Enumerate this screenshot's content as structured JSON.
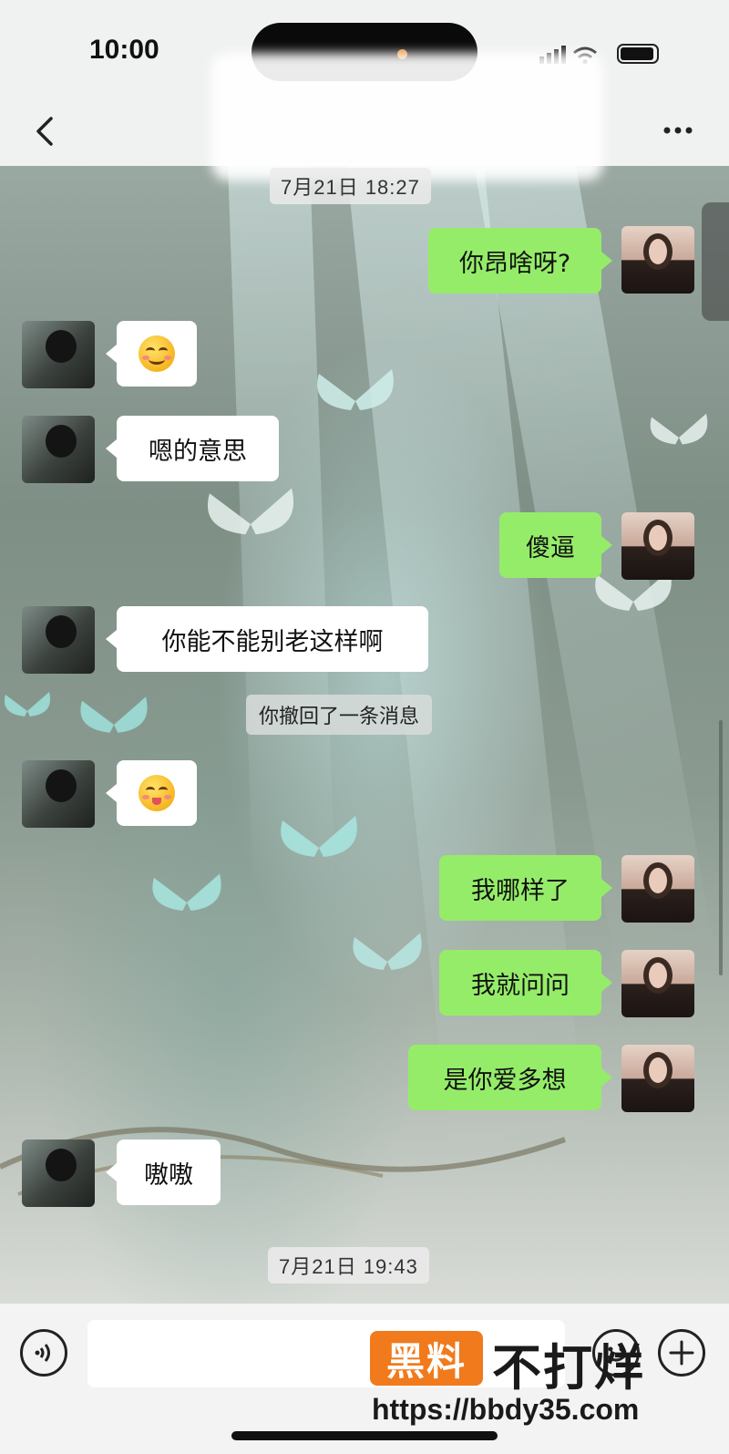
{
  "status": {
    "time": "10:00"
  },
  "timestamps": [
    "7月21日 18:27",
    "7月21日 19:43"
  ],
  "messages": [
    {
      "side": "out",
      "text": "你昂啥呀?"
    },
    {
      "side": "in",
      "emoji": "smiling-face-emoji"
    },
    {
      "side": "in",
      "text": "嗯的意思"
    },
    {
      "side": "out",
      "text": "傻逼"
    },
    {
      "side": "in",
      "text": "你能不能别老这样啊"
    },
    {
      "side": "system",
      "text": "你撤回了一条消息"
    },
    {
      "side": "in",
      "emoji": "tongue-face-emoji"
    },
    {
      "side": "out",
      "text": "我哪样了"
    },
    {
      "side": "out",
      "text": "我就问问"
    },
    {
      "side": "out",
      "text": "是你爱多想"
    },
    {
      "side": "in",
      "text": "嗷嗷"
    }
  ],
  "watermark": {
    "brand": "黑料",
    "slogan": "不打烊",
    "url": "https://bbdy35.com"
  },
  "colors": {
    "outgoing_bubble": "#95ec69",
    "incoming_bubble": "#ffffff",
    "watermark_orange": "#f07a1c"
  },
  "icons": {
    "back": "chevron-left-icon",
    "more": "ellipsis-icon",
    "voice": "voice-icon",
    "emoji": "emoji-icon",
    "plus": "plus-icon"
  }
}
